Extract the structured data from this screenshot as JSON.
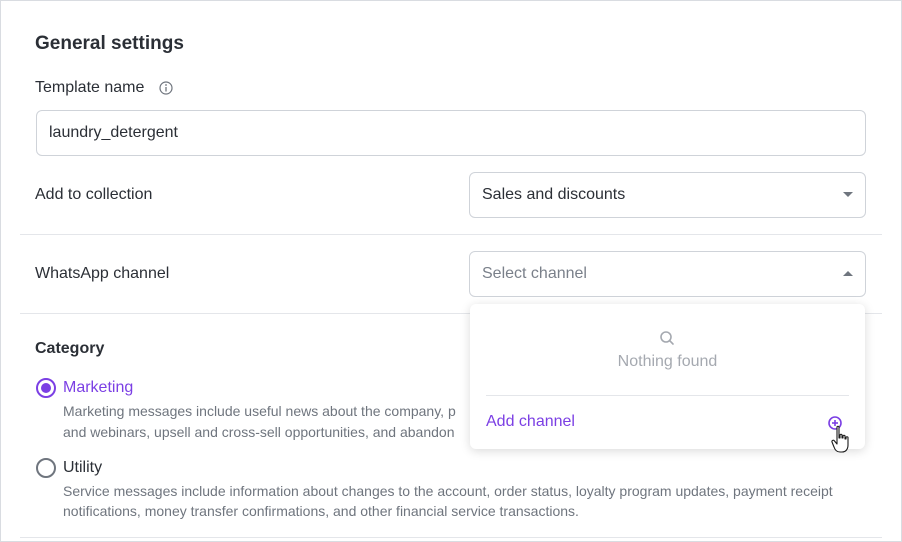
{
  "general": {
    "title": "General settings",
    "template_name_label": "Template name",
    "template_name_value": "laundry_detergent",
    "collection_label": "Add to collection",
    "collection_value": "Sales and discounts",
    "whatsapp_label": "WhatsApp channel",
    "whatsapp_placeholder": "Select channel"
  },
  "dropdown": {
    "empty_text": "Nothing found",
    "add_channel_label": "Add channel"
  },
  "category": {
    "title": "Category",
    "options": [
      {
        "label": "Marketing",
        "selected": true,
        "desc_line1": "Marketing messages include useful news about the company, p",
        "desc_line2": "and webinars, upsell and cross-sell opportunities, and abandon"
      },
      {
        "label": "Utility",
        "selected": false,
        "desc_line1": "Service messages include information about changes to the account, order status, loyalty program updates, payment receipt",
        "desc_line2": "notifications, money transfer confirmations, and other financial service transactions."
      }
    ]
  },
  "colors": {
    "accent": "#7b3fe4",
    "text": "#2b2f36",
    "muted": "#6f757e",
    "border": "#cfd3d9"
  }
}
